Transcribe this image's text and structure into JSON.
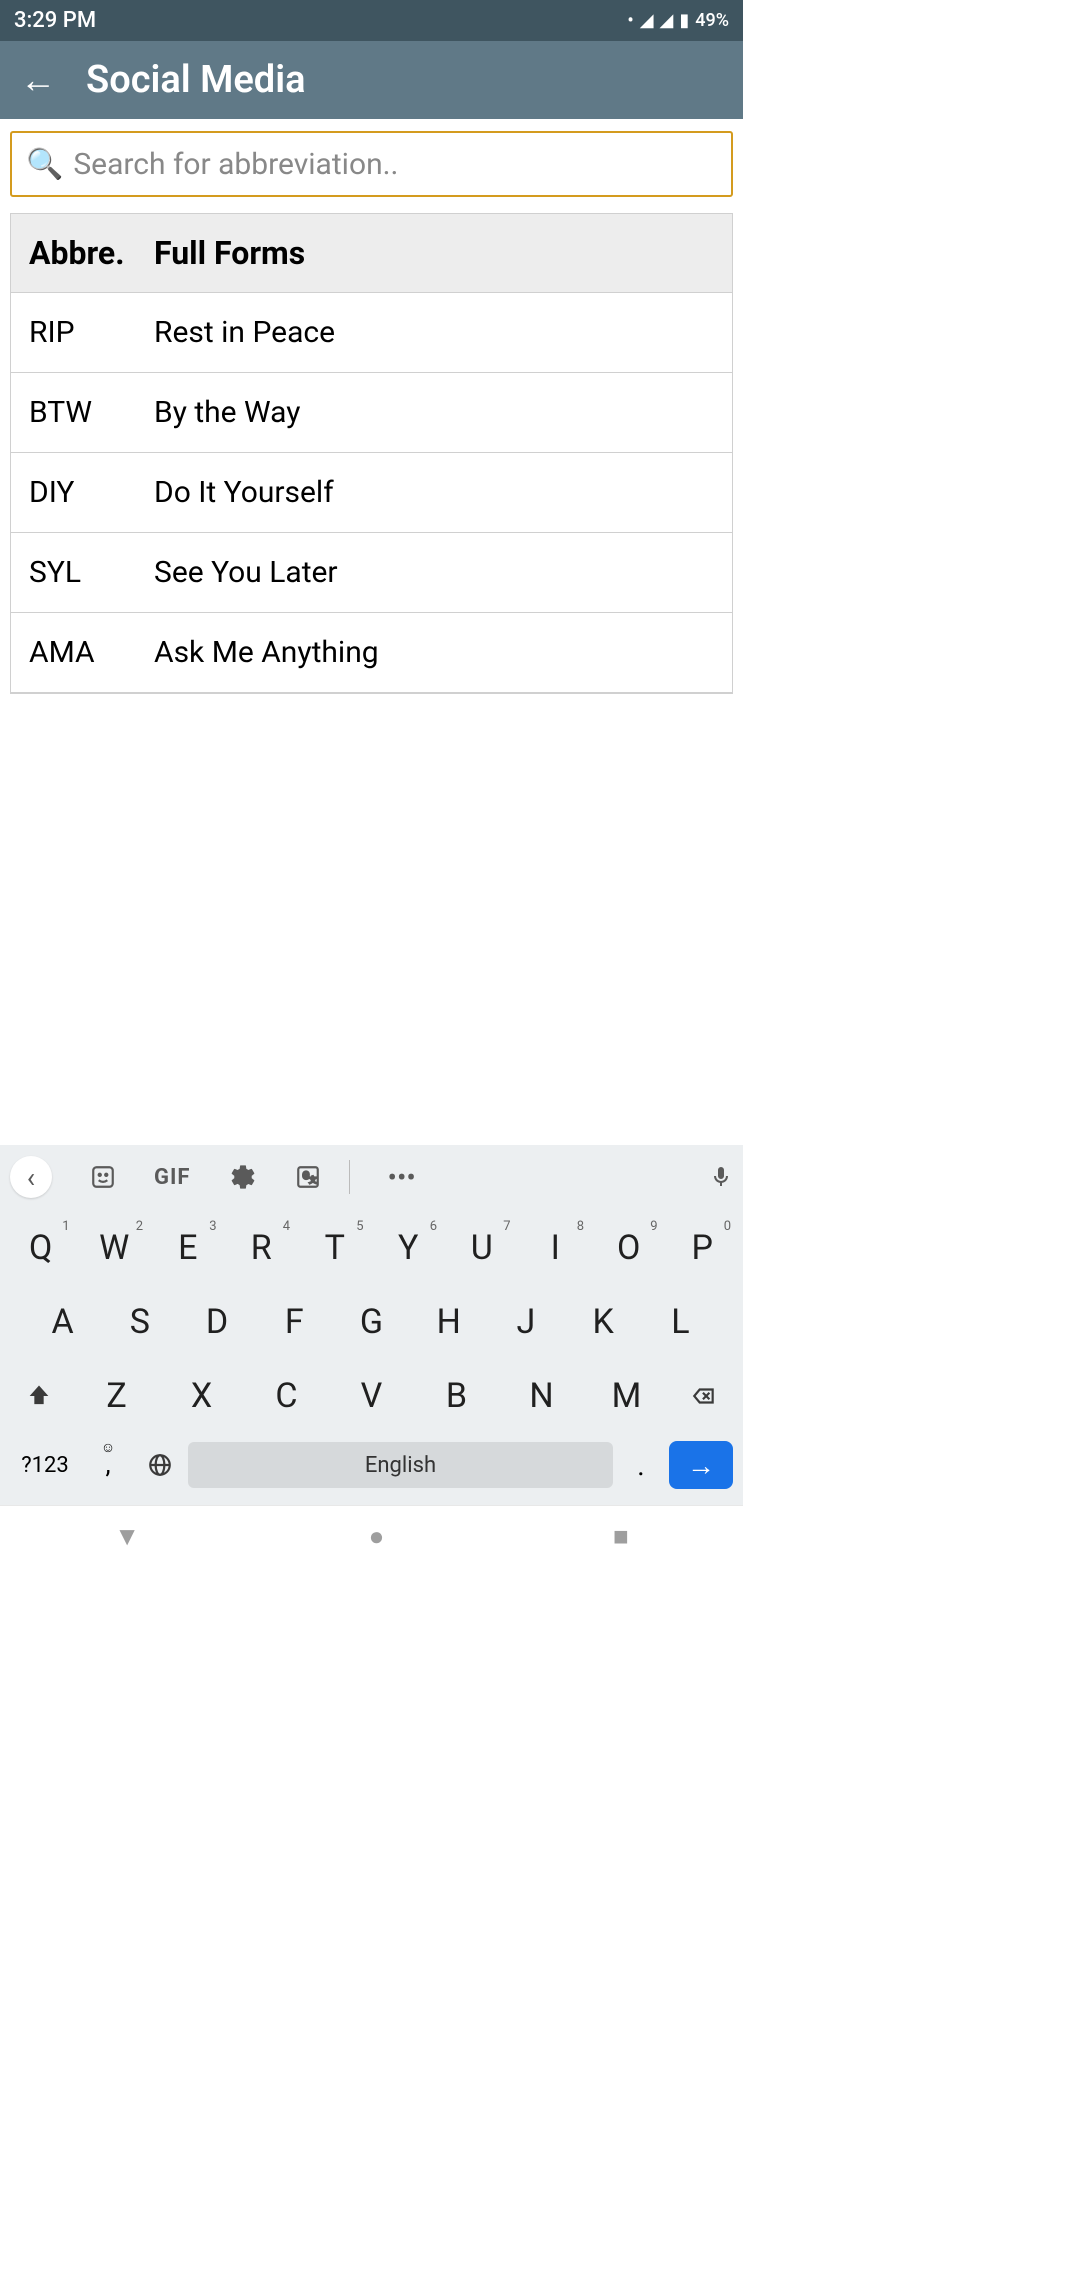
{
  "status": {
    "time": "3:29 PM",
    "battery": "49%"
  },
  "header": {
    "title": "Social Media"
  },
  "search": {
    "placeholder": "Search for abbreviation.."
  },
  "table": {
    "header_abbre": "Abbre.",
    "header_full": "Full Forms",
    "rows": [
      {
        "abbre": "RIP",
        "full": "Rest in Peace"
      },
      {
        "abbre": "BTW",
        "full": "By the Way"
      },
      {
        "abbre": "DIY",
        "full": "Do It Yourself"
      },
      {
        "abbre": "SYL",
        "full": "See You Later"
      },
      {
        "abbre": "AMA",
        "full": "Ask Me Anything"
      }
    ]
  },
  "keyboard": {
    "gif": "GIF",
    "row1": [
      {
        "k": "Q",
        "n": "1"
      },
      {
        "k": "W",
        "n": "2"
      },
      {
        "k": "E",
        "n": "3"
      },
      {
        "k": "R",
        "n": "4"
      },
      {
        "k": "T",
        "n": "5"
      },
      {
        "k": "Y",
        "n": "6"
      },
      {
        "k": "U",
        "n": "7"
      },
      {
        "k": "I",
        "n": "8"
      },
      {
        "k": "O",
        "n": "9"
      },
      {
        "k": "P",
        "n": "0"
      }
    ],
    "row2": [
      "A",
      "S",
      "D",
      "F",
      "G",
      "H",
      "J",
      "K",
      "L"
    ],
    "row3": [
      "Z",
      "X",
      "C",
      "V",
      "B",
      "N",
      "M"
    ],
    "numbers_key": "?123",
    "space_label": "English"
  }
}
